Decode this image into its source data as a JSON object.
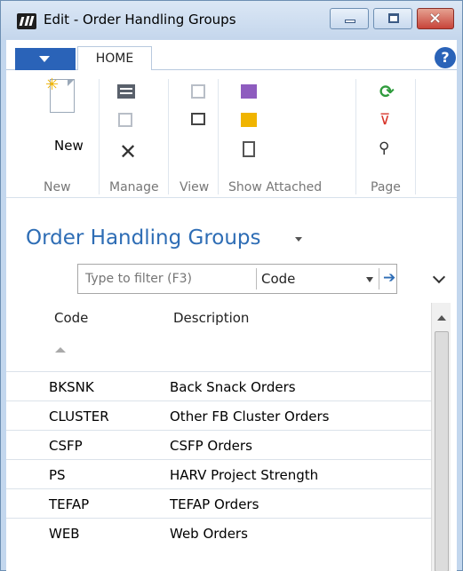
{
  "window": {
    "title": "Edit - Order Handling Groups"
  },
  "ribbon": {
    "tab_home": "HOME",
    "new_label": "New",
    "groups": [
      "New",
      "Manage",
      "View",
      "Show Attached",
      "Page"
    ]
  },
  "page": {
    "title": "Order Handling Groups",
    "filter_placeholder": "Type to filter (F3)",
    "filter_field": "Code"
  },
  "table": {
    "columns": [
      "Code",
      "Description"
    ],
    "rows": [
      {
        "code": "BKSNK",
        "description": "Back Snack Orders"
      },
      {
        "code": "CLUSTER",
        "description": "Other FB Cluster Orders"
      },
      {
        "code": "CSFP",
        "description": "CSFP Orders"
      },
      {
        "code": "PS",
        "description": "HARV Project Strength"
      },
      {
        "code": "TEFAP",
        "description": "TEFAP Orders"
      },
      {
        "code": "WEB",
        "description": "Web Orders"
      }
    ]
  },
  "icons": {
    "app": "dynamics-nav-icon",
    "help": "help-icon",
    "refresh": "refresh-icon",
    "clear_filter": "clear-filter-icon",
    "find": "binoculars-icon"
  }
}
